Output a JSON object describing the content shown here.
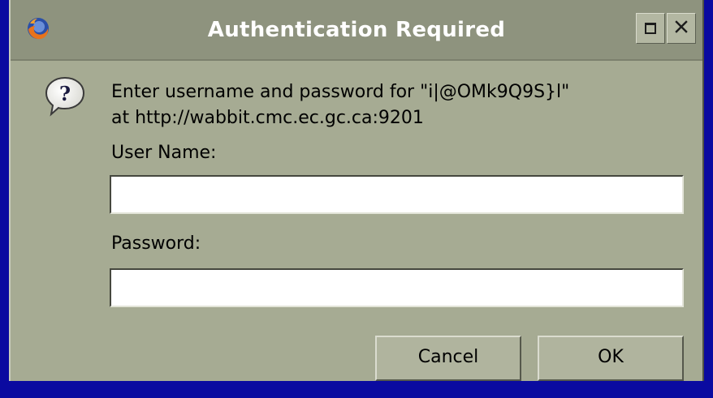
{
  "window": {
    "title": "Authentication Required",
    "app_icon": "firefox-icon",
    "controls": [
      {
        "name": "maximize-icon",
        "glyph": "□"
      },
      {
        "name": "close-icon",
        "glyph": "✕"
      }
    ]
  },
  "dialog": {
    "icon": "question-icon",
    "message_line1": "Enter username and password for \"i|@OMk9Q9S}l\"",
    "message_line2": "at http://wabbit.cmc.ec.gc.ca:9201",
    "username_label": "User Name:",
    "username_value": "",
    "password_label": "Password:",
    "password_value": "",
    "cancel_label": "Cancel",
    "ok_label": "OK"
  },
  "colors": {
    "desktop": "#0a0aa0",
    "titlebar": "#8e937e",
    "dialog_bg": "#a6ab93",
    "title_text": "#ffffff"
  }
}
